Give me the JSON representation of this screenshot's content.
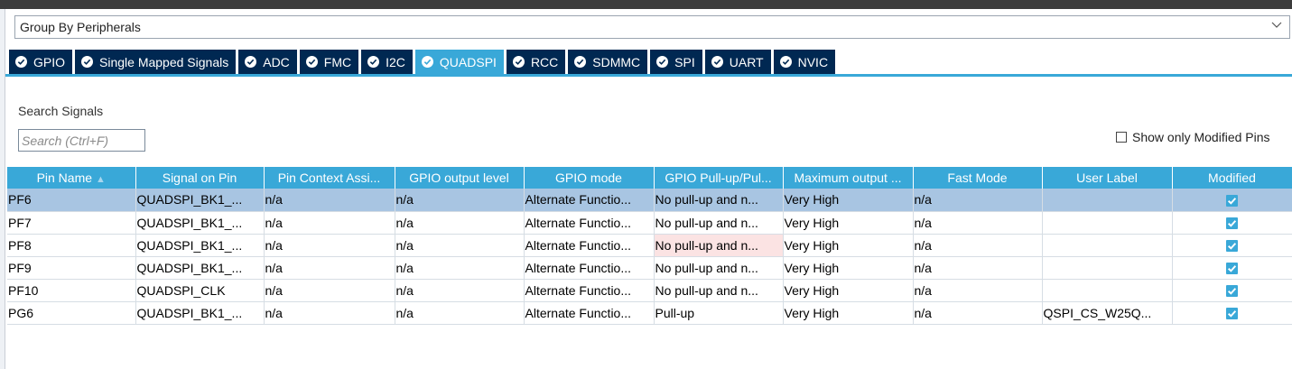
{
  "group_by": {
    "value": "Group By Peripherals"
  },
  "tabs": [
    {
      "label": "GPIO",
      "active": false
    },
    {
      "label": "Single Mapped Signals",
      "active": false
    },
    {
      "label": "ADC",
      "active": false
    },
    {
      "label": "FMC",
      "active": false
    },
    {
      "label": "I2C",
      "active": false
    },
    {
      "label": "QUADSPI",
      "active": true
    },
    {
      "label": "RCC",
      "active": false
    },
    {
      "label": "SDMMC",
      "active": false
    },
    {
      "label": "SPI",
      "active": false
    },
    {
      "label": "UART",
      "active": false
    },
    {
      "label": "NVIC",
      "active": false
    }
  ],
  "search": {
    "label": "Search Signals",
    "placeholder": "Search (Ctrl+F)"
  },
  "show_modified": {
    "label": "Show only Modified Pins",
    "checked": false
  },
  "table": {
    "headers": [
      "Pin Name",
      "Signal on Pin",
      "Pin Context Assi...",
      "GPIO output level",
      "GPIO mode",
      "GPIO Pull-up/Pul...",
      "Maximum output ...",
      "Fast Mode",
      "User Label",
      "Modified"
    ],
    "rows": [
      [
        "PF6",
        "QUADSPI_BK1_...",
        "n/a",
        "n/a",
        "Alternate Functio...",
        "No pull-up and n...",
        "Very High",
        "n/a",
        "",
        true
      ],
      [
        "PF7",
        "QUADSPI_BK1_...",
        "n/a",
        "n/a",
        "Alternate Functio...",
        "No pull-up and n...",
        "Very High",
        "n/a",
        "",
        true
      ],
      [
        "PF8",
        "QUADSPI_BK1_...",
        "n/a",
        "n/a",
        "Alternate Functio...",
        "No pull-up and n...",
        "Very High",
        "n/a",
        "",
        true
      ],
      [
        "PF9",
        "QUADSPI_BK1_...",
        "n/a",
        "n/a",
        "Alternate Functio...",
        "No pull-up and n...",
        "Very High",
        "n/a",
        "",
        true
      ],
      [
        "PF10",
        "QUADSPI_CLK",
        "n/a",
        "n/a",
        "Alternate Functio...",
        "No pull-up and n...",
        "Very High",
        "n/a",
        "",
        true
      ],
      [
        "PG6",
        "QUADSPI_BK1_...",
        "n/a",
        "n/a",
        "Alternate Functio...",
        "Pull-up",
        "Very High",
        "n/a",
        "QSPI_CS_W25Q...",
        true
      ]
    ]
  },
  "colors": {
    "tab_bg": "#002852",
    "accent": "#39a8d8",
    "selected_row": "#a8c5e2"
  }
}
